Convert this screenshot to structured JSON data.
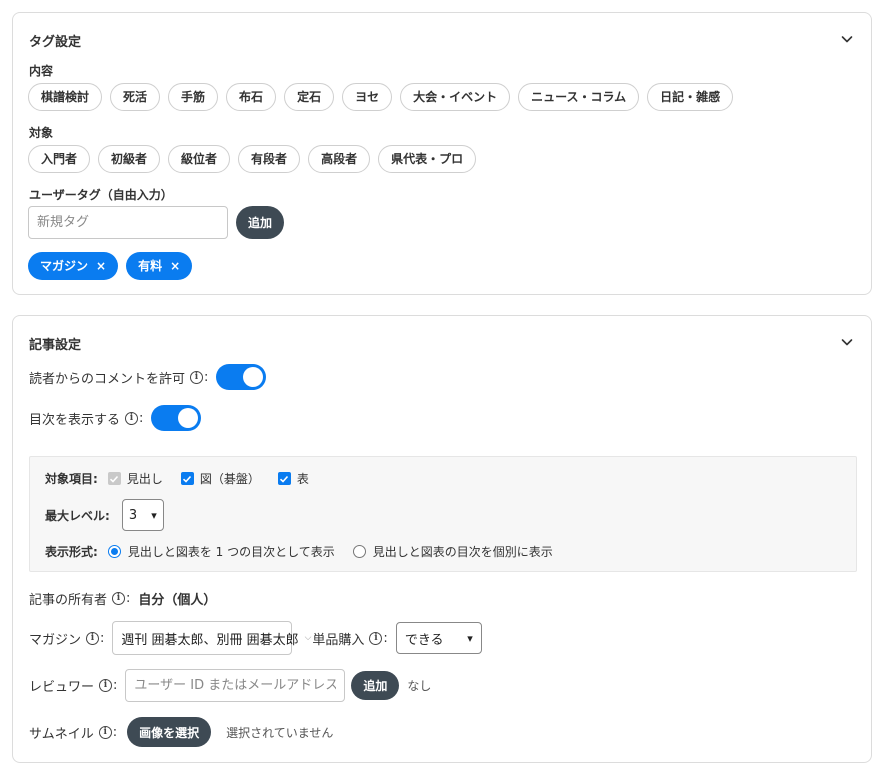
{
  "tag_settings": {
    "title": "タグ設定",
    "content_label": "内容",
    "content_tags": [
      "棋譜検討",
      "死活",
      "手筋",
      "布石",
      "定石",
      "ヨセ",
      "大会・イベント",
      "ニュース・コラム",
      "日記・雑感"
    ],
    "target_label": "対象",
    "target_tags": [
      "入門者",
      "初級者",
      "級位者",
      "有段者",
      "高段者",
      "県代表・プロ"
    ],
    "user_tag_label": "ユーザータグ（自由入力）",
    "new_tag_placeholder": "新規タグ",
    "add_label": "追加",
    "user_tags": [
      "マガジン",
      "有料"
    ],
    "remove_glyph": "×"
  },
  "article_settings": {
    "title": "記事設定",
    "allow_comments_label": "読者からのコメントを許可",
    "allow_comments": true,
    "show_toc_label": "目次を表示する",
    "show_toc": true,
    "toc": {
      "items_label": "対象項目:",
      "items": [
        {
          "label": "見出し",
          "checked": true,
          "disabled": true
        },
        {
          "label": "図（碁盤）",
          "checked": true,
          "disabled": false
        },
        {
          "label": "表",
          "checked": true,
          "disabled": false
        }
      ],
      "max_level_label": "最大レベル:",
      "max_level": "3",
      "format_label": "表示形式:",
      "formats": [
        {
          "label": "見出しと図表を 1 つの目次として表示",
          "selected": true
        },
        {
          "label": "見出しと図表の目次を個別に表示",
          "selected": false
        }
      ]
    },
    "owner_label": "記事の所有者",
    "owner_value": "自分（個人）",
    "magazine_label": "マガジン",
    "magazine_value": "週刊 囲碁太郎、別冊 囲碁太郎",
    "single_purchase_label": "単品購入",
    "single_purchase_value": "できる",
    "reviewer_label": "レビュワー",
    "reviewer_placeholder": "ユーザー ID またはメールアドレス",
    "reviewer_add_label": "追加",
    "reviewer_none": "なし",
    "thumbnail_label": "サムネイル",
    "thumbnail_button": "画像を選択",
    "thumbnail_status": "選択されていません"
  },
  "colors": {
    "accent": "#0a7cf0",
    "dark_button": "#3e4a54"
  },
  "icons": {
    "collapse": "chevron-down-icon",
    "info": "info-icon"
  },
  "info_glyph": "i",
  "colon": ":"
}
